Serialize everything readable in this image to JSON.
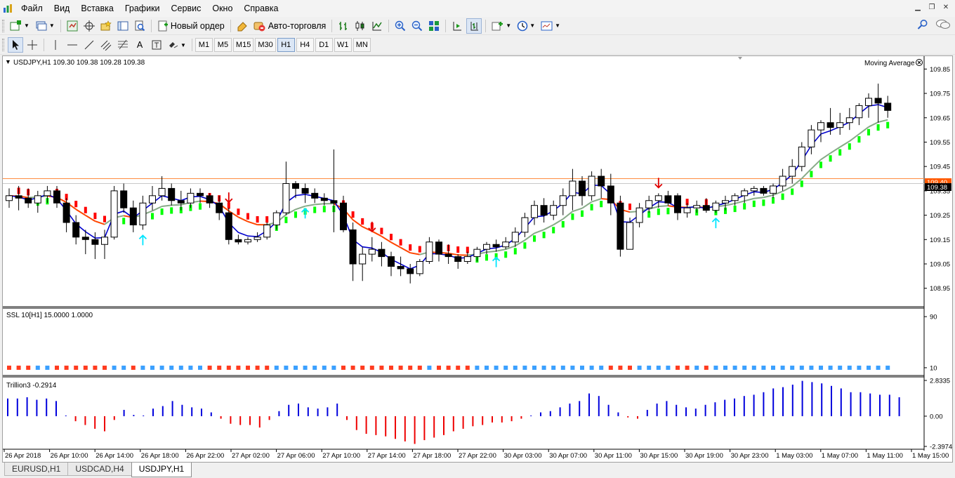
{
  "menu": {
    "items": [
      {
        "label": "Файл"
      },
      {
        "label": "Вид"
      },
      {
        "label": "Вставка"
      },
      {
        "label": "Графики"
      },
      {
        "label": "Сервис"
      },
      {
        "label": "Окно"
      },
      {
        "label": "Справка"
      }
    ]
  },
  "toolbar": {
    "new_order_label": "Новый ордер",
    "autotrade_label": "Авто-торговля",
    "text_tool_label": "A",
    "timeframes": [
      "M1",
      "M5",
      "M15",
      "M30",
      "H1",
      "H4",
      "D1",
      "W1",
      "MN"
    ],
    "active_timeframe": "H1"
  },
  "chart": {
    "symbol_info": "USDJPY,H1  109.30 109.38 109.28 109.38",
    "indicator_name": "Moving Average",
    "current_price": "109.38",
    "line_price": "109.40",
    "colors": {
      "bull_body": "#ffffff",
      "bear_body": "#000000",
      "wick": "#000000",
      "ma_fast": "#0000cc",
      "ma_slow_up": "#88aa88",
      "ma_slow_down": "#ff4500",
      "bar_up": "#00ff00",
      "bar_down": "#ff0000",
      "arrow_up": "#00e5ff",
      "arrow_down": "#e00000",
      "hline": "#ff8c40",
      "price_tag": "#000000",
      "price_tag_line": "#ff5a00"
    }
  },
  "chart_data": [
    {
      "type": "candlestick",
      "title": "USDJPY,H1",
      "ylim": [
        108.88,
        109.9
      ],
      "yticks": [
        "109.85",
        "109.75",
        "109.65",
        "109.55",
        "109.45",
        "109.35",
        "109.25",
        "109.15",
        "109.05",
        "108.95"
      ],
      "x_labels": [
        "26 Apr 2018",
        "26 Apr 10:00",
        "26 Apr 14:00",
        "26 Apr 18:00",
        "26 Apr 22:00",
        "27 Apr 02:00",
        "27 Apr 06:00",
        "27 Apr 10:00",
        "27 Apr 14:00",
        "27 Apr 18:00",
        "27 Apr 22:00",
        "30 Apr 03:00",
        "30 Apr 07:00",
        "30 Apr 11:00",
        "30 Apr 15:00",
        "30 Apr 19:00",
        "30 Apr 23:00",
        "1 May 03:00",
        "1 May 07:00",
        "1 May 11:00",
        "1 May 15:00"
      ],
      "ohlc": [
        [
          109.31,
          109.36,
          109.28,
          109.33
        ],
        [
          109.33,
          109.37,
          109.27,
          109.32
        ],
        [
          109.32,
          109.36,
          109.28,
          109.3
        ],
        [
          109.3,
          109.35,
          109.26,
          109.33
        ],
        [
          109.33,
          109.37,
          109.3,
          109.35
        ],
        [
          109.35,
          109.37,
          109.28,
          109.3
        ],
        [
          109.3,
          109.32,
          109.18,
          109.22
        ],
        [
          109.22,
          109.25,
          109.13,
          109.16
        ],
        [
          109.16,
          109.19,
          109.09,
          109.15
        ],
        [
          109.15,
          109.18,
          109.07,
          109.13
        ],
        [
          109.13,
          109.19,
          109.07,
          109.16
        ],
        [
          109.16,
          109.37,
          109.15,
          109.35
        ],
        [
          109.35,
          109.38,
          109.26,
          109.28
        ],
        [
          109.28,
          109.31,
          109.18,
          109.21
        ],
        [
          109.21,
          109.33,
          109.19,
          109.3
        ],
        [
          109.3,
          109.37,
          109.27,
          109.33
        ],
        [
          109.33,
          109.41,
          109.31,
          109.36
        ],
        [
          109.36,
          109.38,
          109.29,
          109.31
        ],
        [
          109.31,
          109.35,
          109.27,
          109.3
        ],
        [
          109.3,
          109.36,
          109.28,
          109.34
        ],
        [
          109.34,
          109.36,
          109.3,
          109.33
        ],
        [
          109.33,
          109.34,
          109.28,
          109.3
        ],
        [
          109.3,
          109.33,
          109.23,
          109.26
        ],
        [
          109.26,
          109.28,
          109.13,
          109.15
        ],
        [
          109.15,
          109.17,
          109.13,
          109.14
        ],
        [
          109.14,
          109.16,
          109.13,
          109.15
        ],
        [
          109.15,
          109.18,
          109.14,
          109.16
        ],
        [
          109.16,
          109.22,
          109.15,
          109.21
        ],
        [
          109.21,
          109.27,
          109.19,
          109.26
        ],
        [
          109.26,
          109.47,
          109.25,
          109.38
        ],
        [
          109.38,
          109.39,
          109.32,
          109.36
        ],
        [
          109.36,
          109.38,
          109.3,
          109.34
        ],
        [
          109.34,
          109.36,
          109.3,
          109.32
        ],
        [
          109.32,
          109.34,
          109.29,
          109.31
        ],
        [
          109.31,
          109.52,
          109.18,
          109.3
        ],
        [
          109.3,
          109.33,
          109.18,
          109.19
        ],
        [
          109.19,
          109.22,
          108.98,
          109.05
        ],
        [
          109.05,
          109.12,
          108.98,
          109.09
        ],
        [
          109.09,
          109.16,
          109.06,
          109.11
        ],
        [
          109.11,
          109.14,
          109.04,
          109.08
        ],
        [
          109.08,
          109.1,
          109.0,
          109.04
        ],
        [
          109.04,
          109.08,
          109.0,
          109.03
        ],
        [
          109.03,
          109.05,
          108.97,
          109.01
        ],
        [
          109.01,
          109.07,
          109.0,
          109.06
        ],
        [
          109.06,
          109.16,
          109.05,
          109.14
        ],
        [
          109.14,
          109.15,
          109.06,
          109.09
        ],
        [
          109.09,
          109.13,
          109.05,
          109.08
        ],
        [
          109.08,
          109.09,
          109.03,
          109.06
        ],
        [
          109.06,
          109.1,
          109.05,
          109.08
        ],
        [
          109.08,
          109.12,
          109.06,
          109.11
        ],
        [
          109.11,
          109.14,
          109.09,
          109.13
        ],
        [
          109.13,
          109.15,
          109.1,
          109.12
        ],
        [
          109.12,
          109.16,
          109.11,
          109.14
        ],
        [
          109.14,
          109.2,
          109.12,
          109.18
        ],
        [
          109.18,
          109.26,
          109.16,
          109.24
        ],
        [
          109.24,
          109.31,
          109.21,
          109.29
        ],
        [
          109.29,
          109.32,
          109.22,
          109.25
        ],
        [
          109.25,
          109.31,
          109.23,
          109.29
        ],
        [
          109.29,
          109.36,
          109.25,
          109.33
        ],
        [
          109.33,
          109.44,
          109.27,
          109.39
        ],
        [
          109.39,
          109.41,
          109.29,
          109.33
        ],
        [
          109.33,
          109.43,
          109.31,
          109.41
        ],
        [
          109.41,
          109.44,
          109.32,
          109.37
        ],
        [
          109.37,
          109.42,
          109.25,
          109.3
        ],
        [
          109.3,
          109.33,
          109.08,
          109.11
        ],
        [
          109.11,
          109.24,
          109.11,
          109.22
        ],
        [
          109.22,
          109.3,
          109.2,
          109.28
        ],
        [
          109.28,
          109.33,
          109.26,
          109.31
        ],
        [
          109.31,
          109.34,
          109.28,
          109.33
        ],
        [
          109.33,
          109.35,
          109.29,
          109.3
        ],
        [
          109.33,
          109.34,
          109.23,
          109.26
        ],
        [
          109.26,
          109.3,
          109.24,
          109.28
        ],
        [
          109.28,
          109.31,
          109.26,
          109.29
        ],
        [
          109.29,
          109.32,
          109.26,
          109.27
        ],
        [
          109.27,
          109.31,
          109.26,
          109.3
        ],
        [
          109.3,
          109.33,
          109.27,
          109.31
        ],
        [
          109.31,
          109.34,
          109.29,
          109.33
        ],
        [
          109.33,
          109.36,
          109.3,
          109.35
        ],
        [
          109.35,
          109.37,
          109.33,
          109.36
        ],
        [
          109.36,
          109.37,
          109.33,
          109.34
        ],
        [
          109.34,
          109.38,
          109.32,
          109.37
        ],
        [
          109.37,
          109.44,
          109.35,
          109.41
        ],
        [
          109.41,
          109.48,
          109.38,
          109.45
        ],
        [
          109.45,
          109.55,
          109.43,
          109.53
        ],
        [
          109.53,
          109.62,
          109.5,
          109.6
        ],
        [
          109.6,
          109.64,
          109.55,
          109.63
        ],
        [
          109.63,
          109.69,
          109.58,
          109.61
        ],
        [
          109.61,
          109.67,
          109.58,
          109.63
        ],
        [
          109.63,
          109.69,
          109.6,
          109.65
        ],
        [
          109.65,
          109.71,
          109.62,
          109.7
        ],
        [
          109.7,
          109.75,
          109.65,
          109.73
        ],
        [
          109.73,
          109.79,
          109.63,
          109.71
        ],
        [
          109.71,
          109.74,
          109.65,
          109.68
        ]
      ]
    },
    {
      "type": "bar",
      "title": "SSL 10[H1] 15.0000 1.0000",
      "ylim": [
        0,
        100
      ],
      "yticks": [
        "90",
        "10"
      ],
      "value": 10
    },
    {
      "type": "bar",
      "title": "Trillion3 -0.2914",
      "ylim": [
        -2.3974,
        2.8335
      ],
      "yticks": [
        "2.8335",
        "0.00",
        "-2.3974"
      ],
      "values": [
        1.4,
        1.4,
        1.5,
        1.3,
        1.4,
        1.2,
        0.0,
        -0.4,
        -0.7,
        -1.0,
        -1.2,
        -0.3,
        0.5,
        0.1,
        0.0,
        0.6,
        0.8,
        1.2,
        0.9,
        0.7,
        0.6,
        0.3,
        -0.2,
        -0.6,
        -0.7,
        -0.7,
        -0.9,
        -0.3,
        0.4,
        0.9,
        1.0,
        0.7,
        0.6,
        0.7,
        1.0,
        -0.3,
        -1.1,
        -1.4,
        -1.5,
        -1.6,
        -1.8,
        -2.0,
        -2.2,
        -1.9,
        -1.7,
        -1.5,
        -1.2,
        -1.0,
        -0.8,
        -0.7,
        -0.5,
        -0.5,
        -0.4,
        -0.2,
        0.0,
        0.3,
        0.4,
        0.7,
        1.0,
        1.2,
        1.8,
        1.6,
        0.9,
        0.3,
        -0.1,
        -0.2,
        0.5,
        1.0,
        1.2,
        0.9,
        0.7,
        0.6,
        0.9,
        1.1,
        1.3,
        1.4,
        1.6,
        1.7,
        1.9,
        2.2,
        2.3,
        2.5,
        2.8,
        2.7,
        2.6,
        2.4,
        2.2,
        1.9,
        1.9,
        1.8,
        1.7,
        1.7,
        1.5
      ]
    }
  ]
}
